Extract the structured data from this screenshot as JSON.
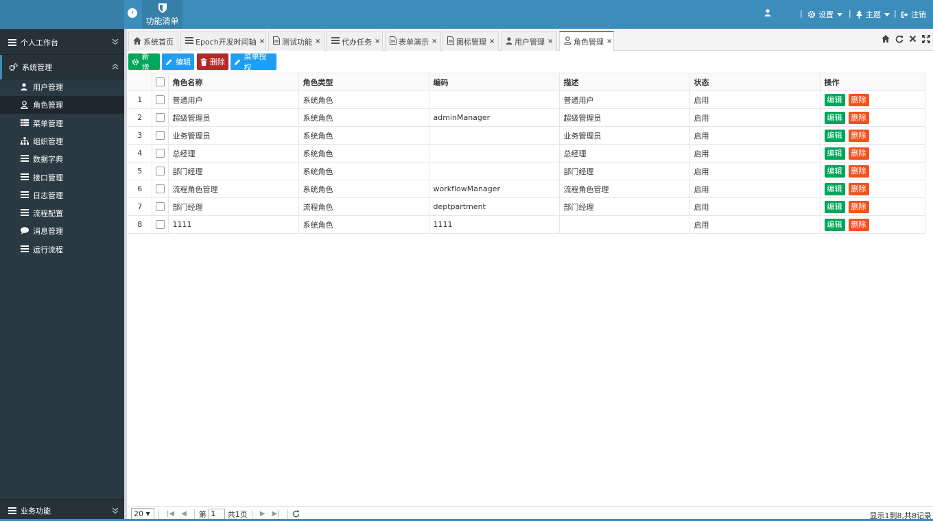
{
  "header": {
    "func_list_label": "功能清单",
    "settings_label": "设置",
    "theme_label": "主题",
    "logout_label": "注销"
  },
  "sidebar": {
    "personal": "个人工作台",
    "system": "系统管理",
    "items": [
      {
        "label": "用户管理",
        "icon": "user-icon"
      },
      {
        "label": "角色管理",
        "icon": "role-user-icon"
      },
      {
        "label": "菜单管理",
        "icon": "menu-grid-icon"
      },
      {
        "label": "组织管理",
        "icon": "org-tree-icon"
      },
      {
        "label": "数据字典",
        "icon": "list-icon"
      },
      {
        "label": "接口管理",
        "icon": "list-icon"
      },
      {
        "label": "日志管理",
        "icon": "list-icon"
      },
      {
        "label": "流程配置",
        "icon": "list-icon"
      },
      {
        "label": "消息管理",
        "icon": "chat-icon"
      },
      {
        "label": "运行流程",
        "icon": "list-icon"
      }
    ],
    "business": "业务功能"
  },
  "tabs": [
    {
      "label": "系统首页",
      "closable": false
    },
    {
      "label": "Epoch开发时间轴",
      "closable": true
    },
    {
      "label": "测试功能",
      "closable": true
    },
    {
      "label": "代办任务",
      "closable": true
    },
    {
      "label": "表单演示",
      "closable": true
    },
    {
      "label": "图标管理",
      "closable": true
    },
    {
      "label": "用户管理",
      "closable": true
    },
    {
      "label": "角色管理",
      "closable": true,
      "active": true
    }
  ],
  "toolbar": {
    "add": "新增",
    "edit": "编辑",
    "delete": "删除",
    "menu_auth": "菜单授权"
  },
  "table": {
    "columns": [
      "角色名称",
      "角色类型",
      "编码",
      "描述",
      "状态",
      "操作"
    ],
    "row_edit": "编辑",
    "row_delete": "删除",
    "rows": [
      {
        "n": "1",
        "name": "普通用户",
        "type": "系统角色",
        "code": "",
        "desc": "普通用户",
        "status": "启用"
      },
      {
        "n": "2",
        "name": "超级管理员",
        "type": "系统角色",
        "code": "adminManager",
        "desc": "超级管理员",
        "status": "启用"
      },
      {
        "n": "3",
        "name": "业务管理员",
        "type": "系统角色",
        "code": "",
        "desc": "业务管理员",
        "status": "启用"
      },
      {
        "n": "4",
        "name": "总经理",
        "type": "系统角色",
        "code": "",
        "desc": "总经理",
        "status": "启用"
      },
      {
        "n": "5",
        "name": "部门经理",
        "type": "系统角色",
        "code": "",
        "desc": "部门经理",
        "status": "启用"
      },
      {
        "n": "6",
        "name": "流程角色管理",
        "type": "系统角色",
        "code": "workflowManager",
        "desc": "流程角色管理",
        "status": "启用"
      },
      {
        "n": "7",
        "name": "部门经理",
        "type": "流程角色",
        "code": "deptpartment",
        "desc": "部门经理",
        "status": "启用"
      },
      {
        "n": "8",
        "name": "1111",
        "type": "系统角色",
        "code": "1111",
        "desc": "",
        "status": "启用"
      }
    ]
  },
  "pager": {
    "page_size": "20",
    "page_prefix": "第",
    "page_value": "1",
    "page_total": "共1页",
    "info": "显示1到8,共8记录"
  },
  "colors": {
    "header": "#3c8dbc",
    "sidebar": "#2b3a42",
    "add_btn": "#00a65a",
    "edit_btn": "#1e9ff2",
    "delete_btn": "#b52828",
    "row_delete": "#f4511e"
  }
}
